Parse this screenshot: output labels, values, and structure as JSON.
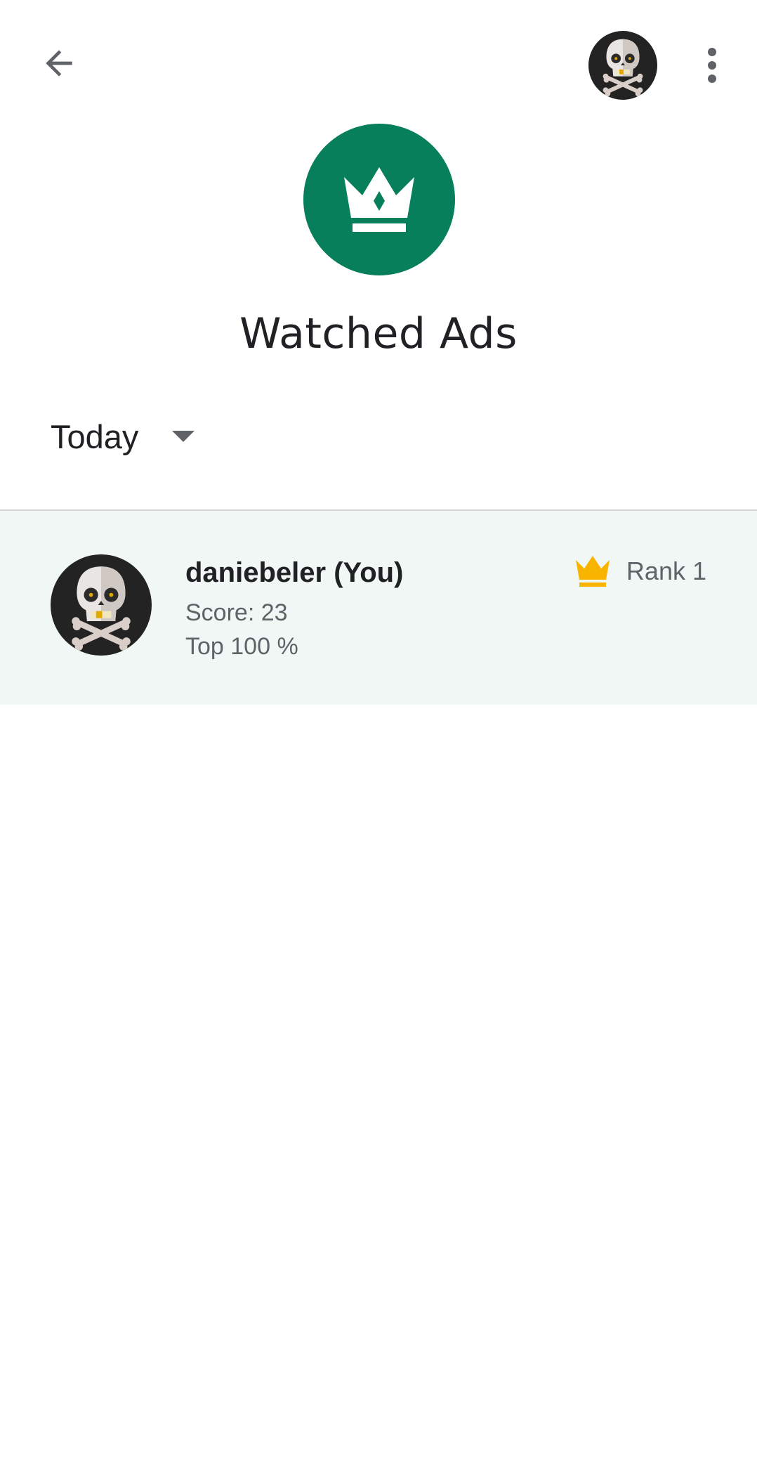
{
  "header": {
    "back_icon": "arrow-back-icon",
    "avatar_icon": "skull-crossbones-avatar-icon",
    "menu_icon": "more-vert-icon"
  },
  "hero": {
    "badge_icon": "crown-icon",
    "badge_color": "#087f5b",
    "title": "Watched Ads"
  },
  "filter": {
    "selected": "Today",
    "caret_icon": "arrow-drop-down-icon"
  },
  "leaderboard": {
    "rows": [
      {
        "name": "daniebeler (You)",
        "score": "Score: 23",
        "top": "Top 100 %",
        "rank": "Rank 1",
        "rank_icon": "gold-crown-icon",
        "rank_color": "#f9b400",
        "highlight_color": "#f0f7f4"
      }
    ]
  }
}
